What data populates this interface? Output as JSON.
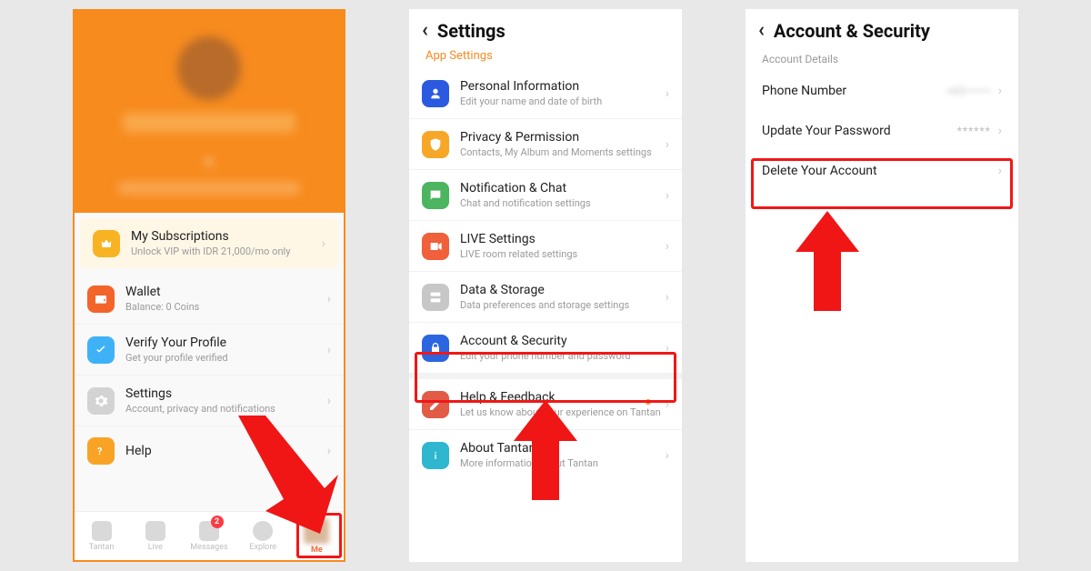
{
  "screen1": {
    "rows": {
      "subs": {
        "title": "My Subscriptions",
        "sub": "Unlock VIP with IDR 21,000/mo only"
      },
      "wallet": {
        "title": "Wallet",
        "sub": "Balance: 0 Coins"
      },
      "verify": {
        "title": "Verify Your Profile",
        "sub": "Get your profile verified"
      },
      "settings": {
        "title": "Settings",
        "sub": "Account, privacy and notifications"
      },
      "help": {
        "title": "Help"
      }
    },
    "tabs": {
      "tantan": "Tantan",
      "live": "Live",
      "messages": "Messages",
      "explore": "Explore",
      "me": "Me",
      "badge": "2"
    }
  },
  "screen2": {
    "title": "Settings",
    "section": "App Settings",
    "rows": {
      "personal": {
        "title": "Personal Information",
        "sub": "Edit your name and date of birth"
      },
      "privacy": {
        "title": "Privacy & Permission",
        "sub": "Contacts, My Album and Moments settings"
      },
      "notif": {
        "title": "Notification & Chat",
        "sub": "Chat and notification settings"
      },
      "live": {
        "title": "LIVE Settings",
        "sub": "LIVE room related settings"
      },
      "data": {
        "title": "Data & Storage",
        "sub": "Data preferences and storage settings"
      },
      "account": {
        "title": "Account & Security",
        "sub": "Edit your phone number and password"
      },
      "helpf": {
        "title": "Help & Feedback",
        "sub": "Let us know about your experience on Tantan"
      },
      "about": {
        "title": "About Tantan",
        "sub": "More information about Tantan"
      }
    }
  },
  "screen3": {
    "title": "Account & Security",
    "section": "Account Details",
    "rows": {
      "phone": {
        "label": "Phone Number",
        "value": "+62•••••••"
      },
      "password": {
        "label": "Update Your Password",
        "value": "******"
      },
      "delete": {
        "label": "Delete Your Account"
      }
    }
  }
}
